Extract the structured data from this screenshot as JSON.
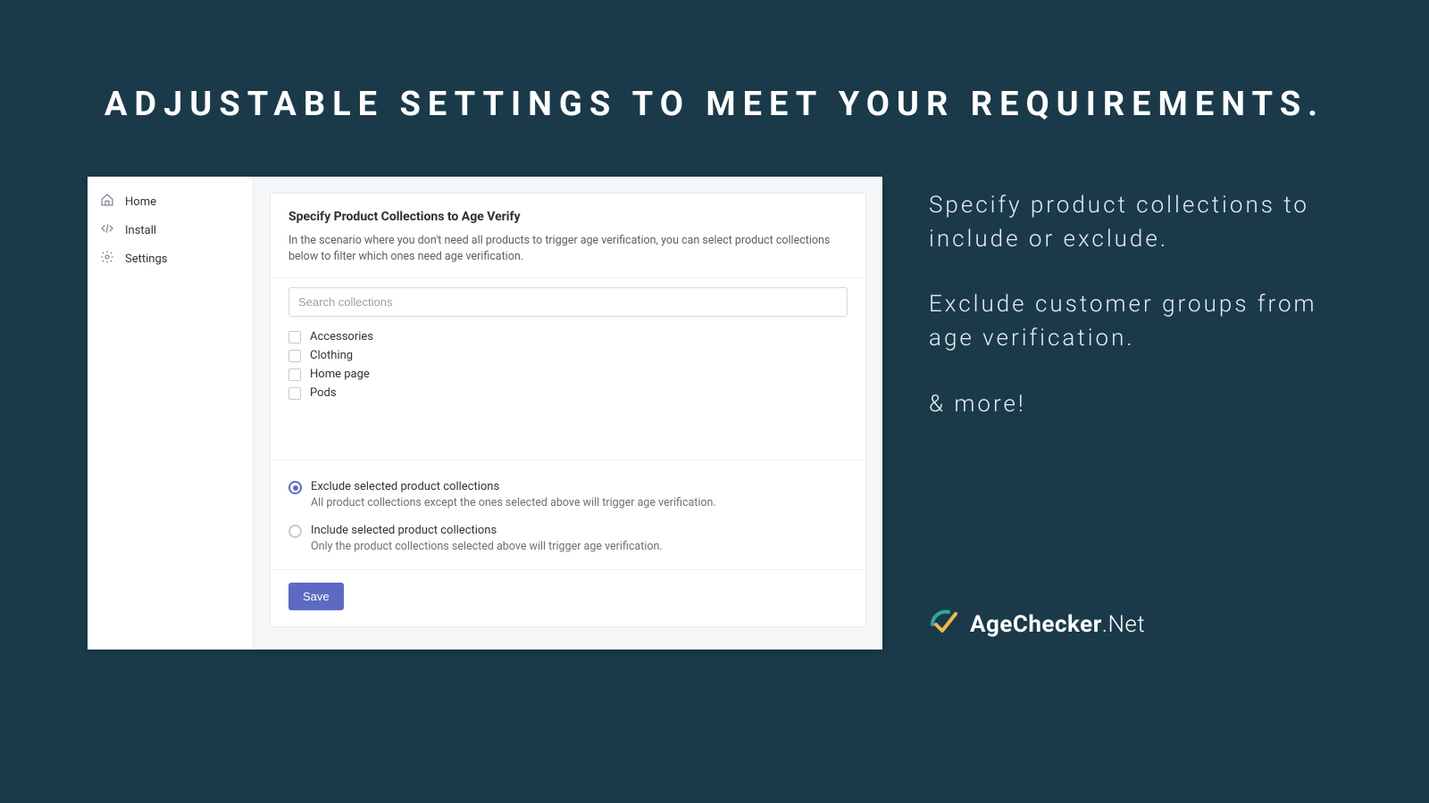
{
  "hero": {
    "title": "ADJUSTABLE SETTINGS TO MEET YOUR REQUIREMENTS."
  },
  "sidebar": {
    "items": [
      {
        "label": "Home"
      },
      {
        "label": "Install"
      },
      {
        "label": "Settings"
      }
    ]
  },
  "card": {
    "title": "Specify Product Collections to Age Verify",
    "description": "In the scenario where you don't need all products to trigger age verification, you can select product collections below to filter which ones need age verification.",
    "search_placeholder": "Search collections",
    "collections": [
      {
        "label": "Accessories"
      },
      {
        "label": "Clothing"
      },
      {
        "label": "Home page"
      },
      {
        "label": "Pods"
      }
    ],
    "radios": [
      {
        "label": "Exclude selected product collections",
        "help": "All product collections except the ones selected above will trigger age verification.",
        "checked": true
      },
      {
        "label": "Include selected product collections",
        "help": "Only the product collections selected above will trigger age verification.",
        "checked": false
      }
    ],
    "save_label": "Save"
  },
  "promo": {
    "p1": "Specify product collections to include or exclude.",
    "p2": "Exclude customer groups from age verification.",
    "p3": "& more!"
  },
  "brand": {
    "bold": "AgeChecker",
    "light": ".Net"
  }
}
